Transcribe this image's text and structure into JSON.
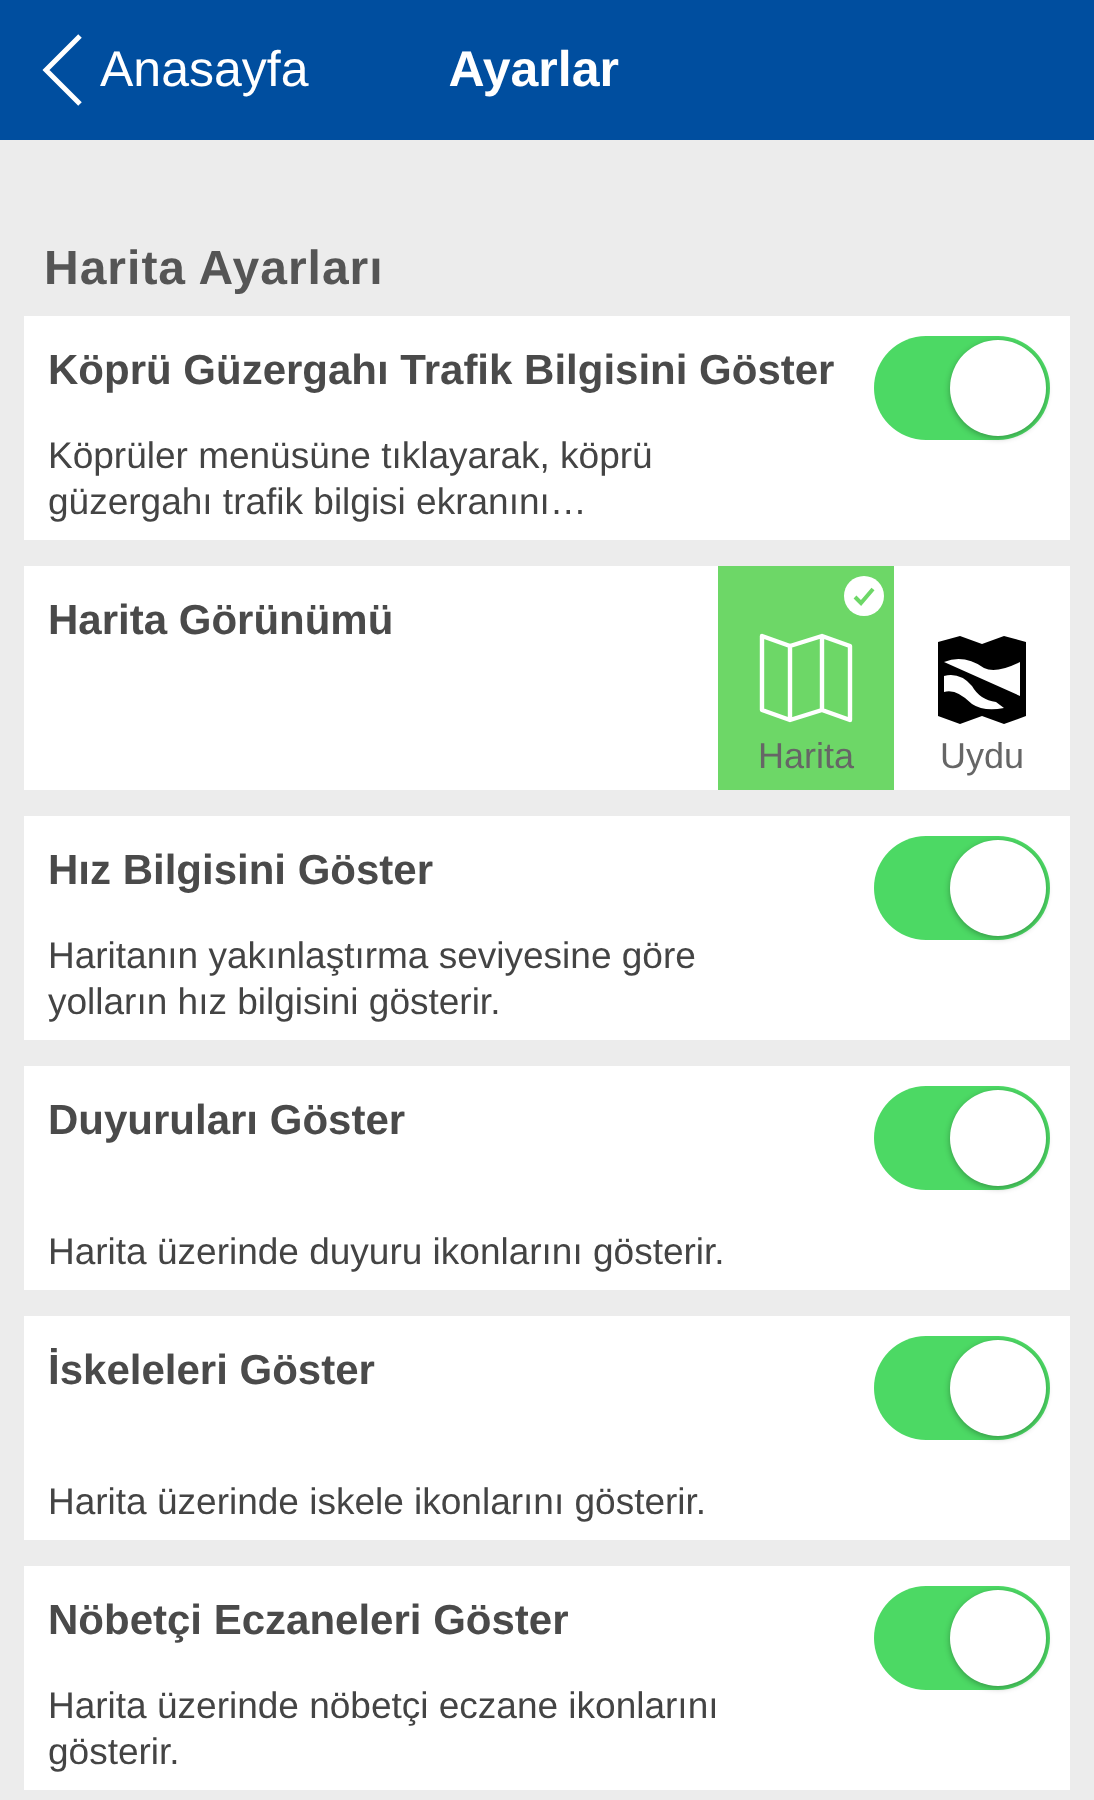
{
  "header": {
    "back_label": "Anasayfa",
    "title": "Ayarlar"
  },
  "section": {
    "title": "Harita Ayarları"
  },
  "items": [
    {
      "kind": "toggle",
      "title": "Köprü Güzergahı Trafik Bilgisini Göster",
      "description": "Köprüler menüsüne tıklayarak, köprü güzergahı trafik bilgisi ekranını…",
      "on": true
    },
    {
      "kind": "view_choice",
      "title": "Harita Görünümü",
      "options": [
        {
          "label": "Harita",
          "selected": true
        },
        {
          "label": "Uydu",
          "selected": false
        }
      ]
    },
    {
      "kind": "toggle",
      "title": "Hız Bilgisini Göster",
      "description": "Haritanın yakınlaştırma seviyesine göre yolların hız bilgisini gösterir.",
      "on": true
    },
    {
      "kind": "toggle",
      "title": "Duyuruları Göster",
      "description": "Harita üzerinde duyuru ikonlarını gösterir.",
      "on": true
    },
    {
      "kind": "toggle",
      "title": "İskeleleri Göster",
      "description": "Harita üzerinde iskele ikonlarını gösterir.",
      "on": true
    },
    {
      "kind": "toggle",
      "title": "Nöbetçi Eczaneleri Göster",
      "description": "Harita üzerinde nöbetçi eczane ikonlarını gösterir.",
      "on": true
    }
  ]
}
